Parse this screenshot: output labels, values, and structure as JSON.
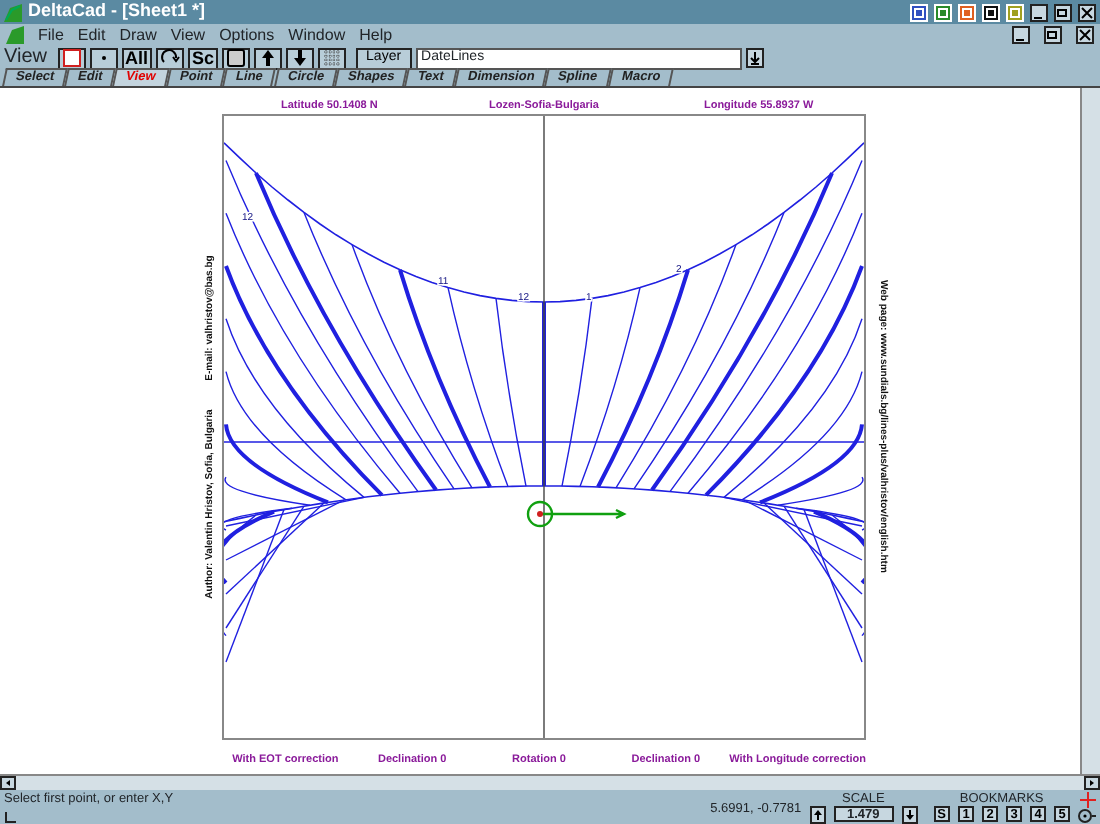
{
  "window": {
    "title": "DeltaCad - [Sheet1 *]"
  },
  "menu": [
    {
      "label": "File"
    },
    {
      "label": "Edit"
    },
    {
      "label": "Draw"
    },
    {
      "label": "View"
    },
    {
      "label": "Options"
    },
    {
      "label": "Window"
    },
    {
      "label": "Help"
    }
  ],
  "toolbar": {
    "label": "View",
    "buttons": [
      {
        "kind": "window"
      },
      {
        "kind": "dot"
      },
      {
        "kind": "text",
        "label": "All"
      },
      {
        "kind": "rotate"
      },
      {
        "kind": "text",
        "label": "Sc"
      },
      {
        "kind": "frame"
      },
      {
        "kind": "up"
      },
      {
        "kind": "down"
      },
      {
        "kind": "grid"
      }
    ],
    "layer_button": "Layer",
    "layer_value": "DateLines"
  },
  "tabs": [
    {
      "label": "Select",
      "selected": false
    },
    {
      "label": "Edit",
      "selected": false
    },
    {
      "label": "View",
      "selected": true
    },
    {
      "label": "Point",
      "selected": false
    },
    {
      "label": "Line",
      "selected": false
    },
    {
      "label": "Circle",
      "selected": false
    },
    {
      "label": "Shapes",
      "selected": false
    },
    {
      "label": "Text",
      "selected": false
    },
    {
      "label": "Dimension",
      "selected": false
    },
    {
      "label": "Spline",
      "selected": false
    },
    {
      "label": "Macro",
      "selected": false
    }
  ],
  "drawing": {
    "top_labels": [
      "Latitude 50.1408 N",
      "Lozen-Sofia-Bulgaria",
      "Longitude 55.8937 W"
    ],
    "left_notes": [
      "Author: Valentin Hristov, Sofia, Bulgaria",
      "E-mail: valhristov@bas.bg"
    ],
    "right_note": "Web page: www.sundials.bg/lines-plus/valhristov/english.htm",
    "hour_labels": [
      "12",
      "11",
      "12",
      "1",
      "2"
    ],
    "bottom_labels": [
      "With EOT correction",
      "Declination 0",
      "Rotation 0",
      "Declination 0",
      "With Longitude correction"
    ]
  },
  "status": {
    "prompt": "Select first point, or enter X,Y",
    "coords": "5.6991, -0.7781",
    "scale_label": "SCALE",
    "scale": "1.479",
    "bookmarks_label": "BOOKMARKS",
    "bookmarks": [
      "S",
      "1",
      "2",
      "3",
      "4",
      "5"
    ]
  }
}
